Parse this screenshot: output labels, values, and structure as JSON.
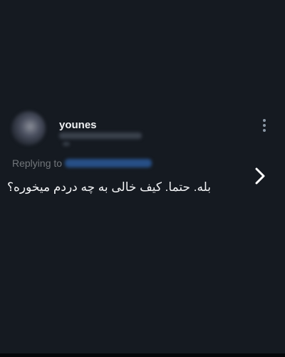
{
  "tweet": {
    "display_name": "younes",
    "replying_label": "Replying to",
    "text": "بله. حتما. کیف خالی به چه دردم میخوره؟",
    "more_icon": "more-vertical-icon",
    "next_icon": "chevron-right-icon"
  },
  "colors": {
    "background": "#151a21",
    "text": "#e7e9ea",
    "muted": "#71767b",
    "link": "#1d9bf0"
  }
}
